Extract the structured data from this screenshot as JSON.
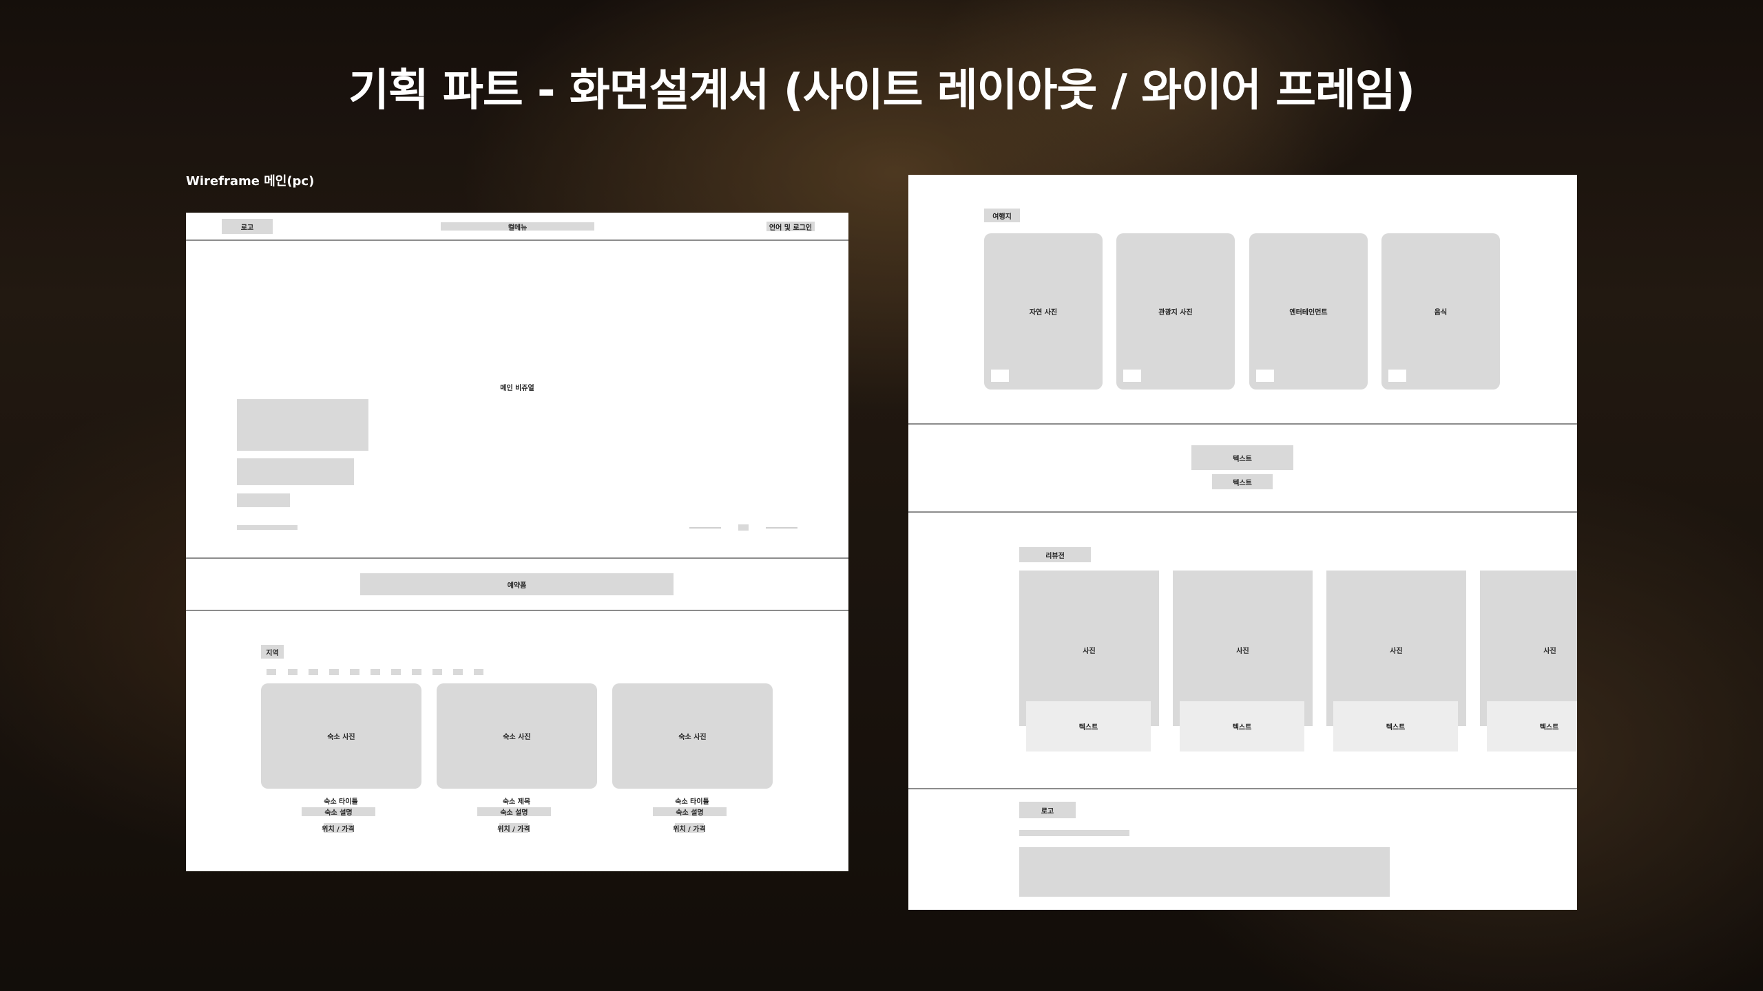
{
  "title": "기획 파트 - 화면설계서 (사이트 레이아웃 / 와이어 프레임)",
  "left_frame": {
    "caption": "Wireframe 메인(pc)",
    "header": {
      "logo": "로고",
      "menu": "컬메뉴",
      "lang_login": "언어 및 로그인"
    },
    "hero": {
      "label": "메인 비쥬얼"
    },
    "booking": {
      "label": "예약폼"
    },
    "region": {
      "label": "지역",
      "cards": [
        {
          "photo": "숙소 사진",
          "title": "숙소 타이틀",
          "desc": "숙소 설명",
          "meta": "위치 / 가격"
        },
        {
          "photo": "숙소 사진",
          "title": "숙소 제목",
          "desc": "숙소 설명",
          "meta": "위치 / 가격"
        },
        {
          "photo": "숙소 사진",
          "title": "숙소 타이틀",
          "desc": "숙소 설명",
          "meta": "위치 / 가격"
        }
      ]
    }
  },
  "right_frame": {
    "travel": {
      "label": "여행지",
      "cards": [
        {
          "label": "자연 사진"
        },
        {
          "label": "관광지 사진"
        },
        {
          "label": "엔터테인먼트"
        },
        {
          "label": "음식"
        }
      ]
    },
    "text_block": {
      "line1": "텍스트",
      "line2": "텍스트"
    },
    "review": {
      "label": "리뷰전",
      "cards": [
        {
          "photo": "사진",
          "text": "텍스트"
        },
        {
          "photo": "사진",
          "text": "텍스트"
        },
        {
          "photo": "사진",
          "text": "텍스트"
        },
        {
          "photo": "사진",
          "text": "텍스트"
        }
      ]
    },
    "footer": {
      "logo": "로고"
    }
  },
  "colors": {
    "wire_gray": "#d9d9d9",
    "wire_light": "#ededed",
    "divider": "#8c8c8c",
    "frame_bg": "#ffffff"
  }
}
